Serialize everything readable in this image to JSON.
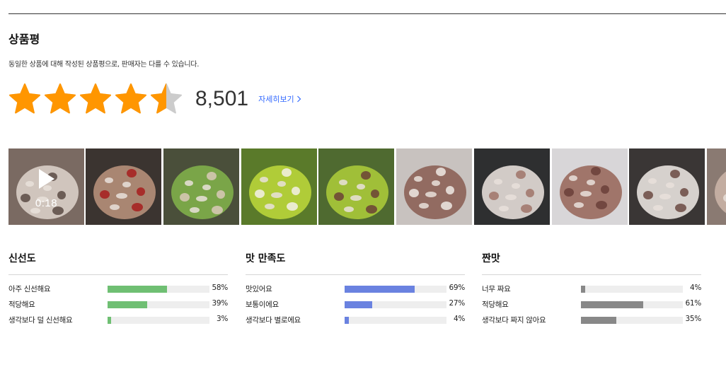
{
  "review": {
    "title": "상품평",
    "description": "동일한 상품에 대해 작성된 상품평으로, 판매자는 다를 수 있습니다.",
    "rating": 4.5,
    "rating_max": 5,
    "count": "8,501",
    "detail_link": "자세히보기",
    "star_color": "#ff9600",
    "star_empty_color": "#cccccc"
  },
  "media": {
    "video_duration": "0:18",
    "thumbnails": [
      {
        "kind": "video"
      },
      {
        "kind": "photo"
      },
      {
        "kind": "photo"
      },
      {
        "kind": "photo"
      },
      {
        "kind": "photo"
      },
      {
        "kind": "photo"
      },
      {
        "kind": "photo"
      },
      {
        "kind": "photo"
      },
      {
        "kind": "photo"
      },
      {
        "kind": "photo"
      }
    ]
  },
  "surveys": [
    {
      "title": "신선도",
      "color": "#6fbf73",
      "options": [
        {
          "label": "아주 신선해요",
          "percent": 58,
          "percent_text": "58%"
        },
        {
          "label": "적당해요",
          "percent": 39,
          "percent_text": "39%"
        },
        {
          "label": "생각보다 덜 신선해요",
          "percent": 3,
          "percent_text": "3%"
        }
      ]
    },
    {
      "title": "맛 만족도",
      "color": "#6a82e0",
      "options": [
        {
          "label": "맛있어요",
          "percent": 69,
          "percent_text": "69%"
        },
        {
          "label": "보통이에요",
          "percent": 27,
          "percent_text": "27%"
        },
        {
          "label": "생각보다 별로에요",
          "percent": 4,
          "percent_text": "4%"
        }
      ]
    },
    {
      "title": "짠맛",
      "color": "#888888",
      "options": [
        {
          "label": "너무 짜요",
          "percent": 4,
          "percent_text": "4%"
        },
        {
          "label": "적당해요",
          "percent": 61,
          "percent_text": "61%"
        },
        {
          "label": "생각보다 짜지 않아요",
          "percent": 35,
          "percent_text": "35%"
        }
      ]
    }
  ]
}
